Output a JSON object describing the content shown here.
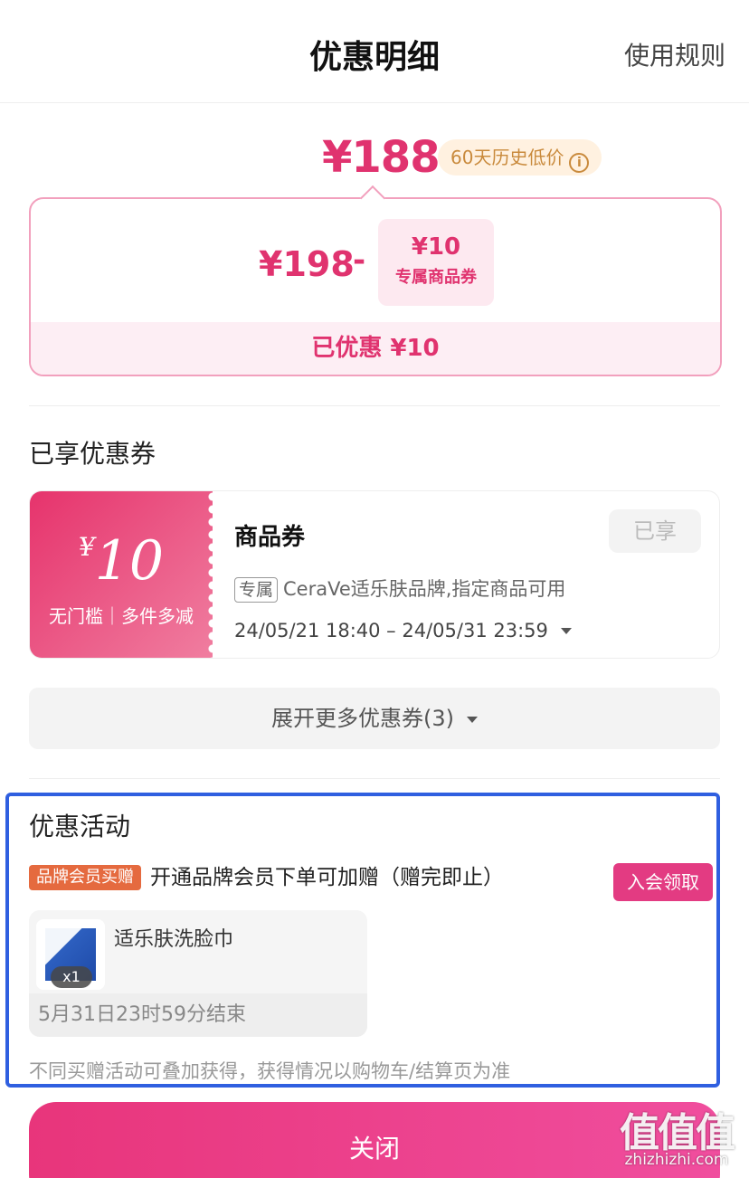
{
  "header": {
    "title": "优惠明细",
    "rules_link": "使用规则"
  },
  "price": {
    "final": "¥188",
    "low_badge": "60天历史低价",
    "original": "¥198",
    "minus": "-",
    "coupon_amount": "¥10",
    "coupon_label": "专属商品券",
    "saved": "已优惠 ¥10"
  },
  "coupons_section": {
    "title": "已享优惠券",
    "card": {
      "currency": "¥",
      "value": "10",
      "tags": "无门槛｜多件多减",
      "type": "商品券",
      "status": "已享",
      "tag": "专属",
      "description": "CeraVe适乐肤品牌,指定商品可用",
      "date_range": "24/05/21 18:40 – 24/05/31 23:59"
    },
    "expand_label": "展开更多优惠券(3)"
  },
  "promo_section": {
    "title": "优惠活动",
    "badge": "品牌会员买赠",
    "text": "开通品牌会员下单可加赠（赠完即止）",
    "join_button": "入会领取",
    "gift": {
      "name": "适乐肤洗脸巾",
      "qty": "x1",
      "end_time": "5月31日23时59分结束"
    },
    "fine_print": "不同买赠活动可叠加获得，获得情况以购物车/结算页为准"
  },
  "close_button": "关闭",
  "watermark": {
    "big": "值值值",
    "small": "zhizhizhi.com"
  },
  "colors": {
    "accent": "#e0336f",
    "highlight_border": "#2f5fe0",
    "promo_badge": "#e56a3f",
    "join_button": "#e33b82"
  }
}
